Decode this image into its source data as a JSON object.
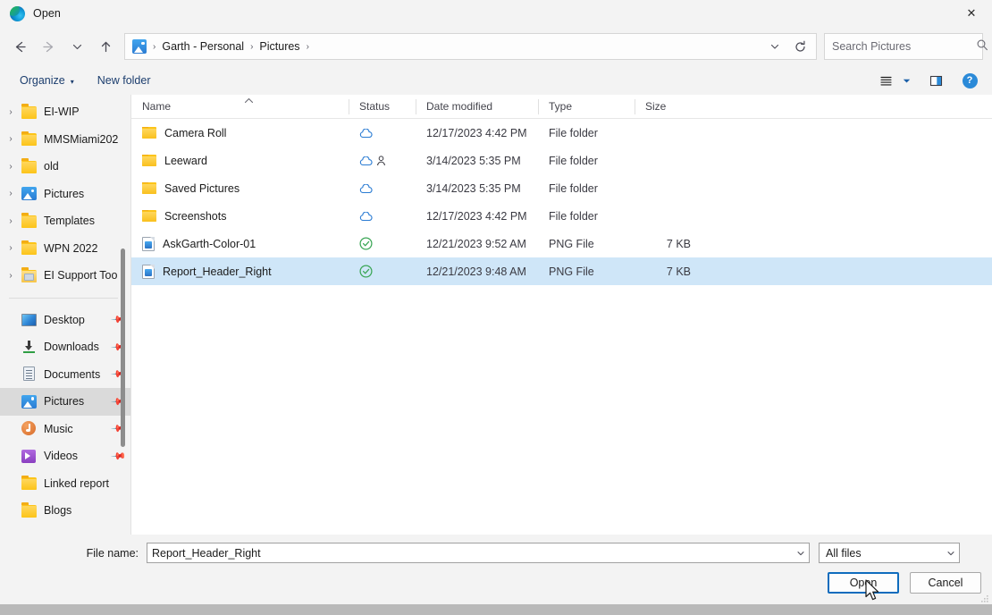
{
  "window": {
    "title": "Open",
    "app_icon": "edge-logo-icon",
    "close_label": "✕"
  },
  "nav": {
    "back": "back-arrow-icon",
    "forward": "forward-arrow-icon",
    "recent": "chevron-down-icon",
    "up": "up-arrow-icon",
    "breadcrumb": [
      {
        "label": "Garth - Personal"
      },
      {
        "label": "Pictures"
      }
    ],
    "breadcrumb_separator": "›",
    "history_dropdown": "chevron-down-icon",
    "refresh": "refresh-icon"
  },
  "search": {
    "placeholder": "Search Pictures",
    "value": "",
    "icon": "search-icon"
  },
  "command_bar": {
    "organize": "Organize",
    "organize_caret": "▾",
    "new_folder": "New folder",
    "view_options": "view-list-icon",
    "view_caret": "▾",
    "preview_pane": "preview-pane-icon",
    "help": "?"
  },
  "sidebar": {
    "tree_items": [
      {
        "label": "EI-WIP",
        "icon": "folder-icon",
        "expandable": true
      },
      {
        "label": "MMSMiami202",
        "icon": "folder-icon",
        "expandable": true
      },
      {
        "label": "old",
        "icon": "folder-icon",
        "expandable": true
      },
      {
        "label": "Pictures",
        "icon": "pictures-library-icon",
        "expandable": true
      },
      {
        "label": "Templates",
        "icon": "folder-icon",
        "expandable": true
      },
      {
        "label": "WPN 2022",
        "icon": "folder-icon",
        "expandable": true
      },
      {
        "label": "EI Support Too",
        "icon": "shared-folder-icon",
        "expandable": true
      }
    ],
    "quick_items": [
      {
        "label": "Desktop",
        "icon": "desktop-icon",
        "pinned": true,
        "selected": false
      },
      {
        "label": "Downloads",
        "icon": "downloads-icon",
        "pinned": true,
        "selected": false
      },
      {
        "label": "Documents",
        "icon": "documents-icon",
        "pinned": true,
        "selected": false
      },
      {
        "label": "Pictures",
        "icon": "pictures-library-icon",
        "pinned": true,
        "selected": true
      },
      {
        "label": "Music",
        "icon": "music-icon",
        "pinned": true,
        "selected": false
      },
      {
        "label": "Videos",
        "icon": "videos-icon",
        "pinned": true,
        "selected": false
      },
      {
        "label": "Linked report",
        "icon": "folder-icon",
        "pinned": false,
        "selected": false
      },
      {
        "label": "Blogs",
        "icon": "folder-icon",
        "pinned": false,
        "selected": false
      }
    ],
    "pin_icon": "pin-icon"
  },
  "file_list": {
    "columns": [
      {
        "label": "Name",
        "sorted": true,
        "sort_caret": "⌃"
      },
      {
        "label": "Status"
      },
      {
        "label": "Date modified"
      },
      {
        "label": "Type"
      },
      {
        "label": "Size"
      }
    ],
    "rows": [
      {
        "name": "Camera Roll",
        "icon": "folder-icon",
        "status": "cloud-icon",
        "shared": false,
        "date": "12/17/2023 4:42 PM",
        "type": "File folder",
        "size": "",
        "selected": false
      },
      {
        "name": "Leeward",
        "icon": "folder-icon",
        "status": "cloud-icon",
        "shared": true,
        "date": "3/14/2023 5:35 PM",
        "type": "File folder",
        "size": "",
        "selected": false
      },
      {
        "name": "Saved Pictures",
        "icon": "folder-icon",
        "status": "cloud-icon",
        "shared": false,
        "date": "3/14/2023 5:35 PM",
        "type": "File folder",
        "size": "",
        "selected": false
      },
      {
        "name": "Screenshots",
        "icon": "folder-icon",
        "status": "cloud-icon",
        "shared": false,
        "date": "12/17/2023 4:42 PM",
        "type": "File folder",
        "size": "",
        "selected": false
      },
      {
        "name": "AskGarth-Color-01",
        "icon": "png-file-icon",
        "status": "synced-check-icon",
        "shared": false,
        "date": "12/21/2023 9:52 AM",
        "type": "PNG File",
        "size": "7 KB",
        "selected": false
      },
      {
        "name": "Report_Header_Right",
        "icon": "png-file-icon",
        "status": "synced-check-icon",
        "shared": false,
        "date": "12/21/2023 9:48 AM",
        "type": "PNG File",
        "size": "7 KB",
        "selected": true
      }
    ]
  },
  "footer": {
    "file_name_label": "File name:",
    "file_name_value": "Report_Header_Right",
    "file_name_caret": "▾",
    "file_type_value": "All files",
    "file_type_caret": "▾",
    "open_button": "Open",
    "cancel_button": "Cancel"
  },
  "colors": {
    "accent": "#0f6cbd",
    "selection": "#cfe6f8",
    "folder": "#fcc419",
    "cloud": "#2b7cd3",
    "synced": "#3aa655",
    "link_text": "#1c3e6e"
  }
}
